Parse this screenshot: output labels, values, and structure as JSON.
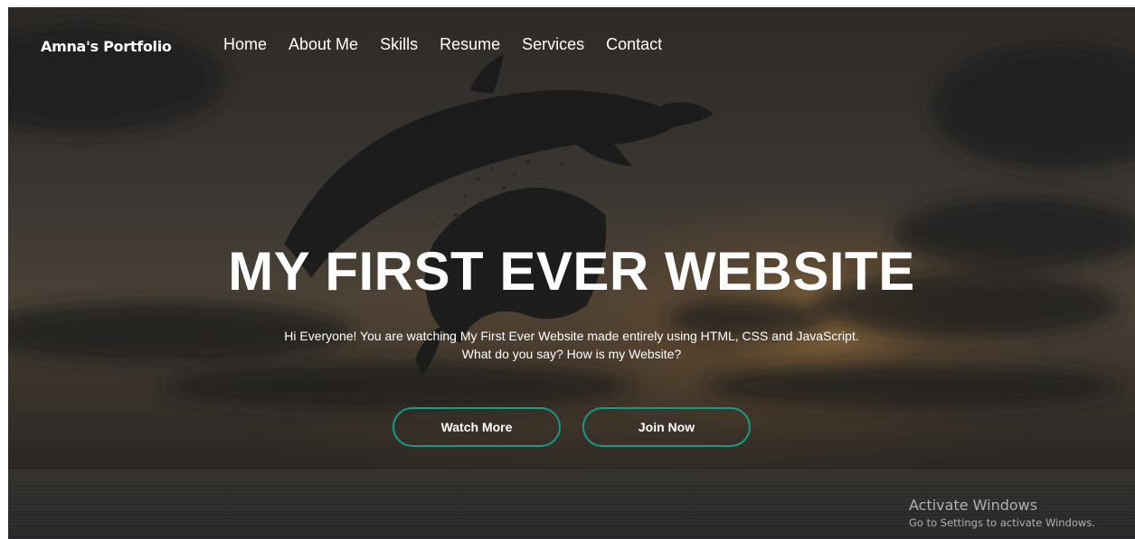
{
  "navbar": {
    "brand": "Amna's Portfolio",
    "links": [
      "Home",
      "About Me",
      "Skills",
      "Resume",
      "Services",
      "Contact"
    ]
  },
  "hero": {
    "title": "MY FIRST EVER WEBSITE",
    "text_line1": "Hi Everyone! You are watching My First Ever Website made entirely using HTML, CSS and JavaScript.",
    "text_line2": "What do you say? How is my Website?",
    "buttons": {
      "watch_more": "Watch More",
      "join_now": "Join Now"
    }
  },
  "watermark": {
    "title": "Activate Windows",
    "subtitle": "Go to Settings to activate Windows."
  },
  "colors": {
    "accent": "#159b86",
    "text": "#ffffff",
    "overlay": "#2d2a27"
  }
}
